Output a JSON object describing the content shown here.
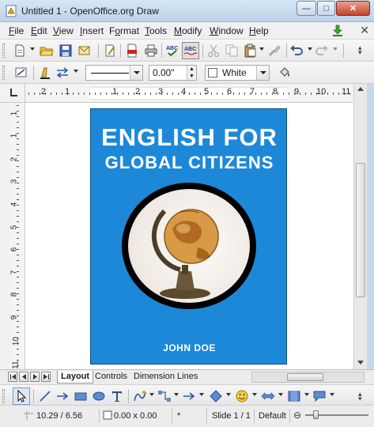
{
  "window": {
    "title": "Untitled 1 - OpenOffice.org Draw",
    "app_icon": "openoffice-draw-icon",
    "buttons": [
      "minimize-icon",
      "maximize-icon",
      "close-icon"
    ]
  },
  "menubar": {
    "items": [
      {
        "label": "File",
        "key": "F",
        "rest": "ile"
      },
      {
        "label": "Edit",
        "key": "E",
        "rest": "dit"
      },
      {
        "label": "View",
        "key": "V",
        "rest": "iew"
      },
      {
        "label": "Insert",
        "key": "I",
        "rest": "nsert"
      },
      {
        "label": "Format",
        "key": "o",
        "pre": "F",
        "rest": "rmat"
      },
      {
        "label": "Tools",
        "key": "T",
        "rest": "ools"
      },
      {
        "label": "Modify",
        "key": "M",
        "rest": "odify"
      },
      {
        "label": "Window",
        "key": "W",
        "rest": "indow"
      },
      {
        "label": "Help",
        "key": "H",
        "rest": "elp"
      }
    ]
  },
  "line_toolbar": {
    "line_width": "0.00\"",
    "fill_color": "White"
  },
  "ruler": {
    "h_labels": [
      "2",
      "1",
      "1",
      "2",
      "3",
      "4",
      "5",
      "6",
      "7",
      "8",
      "9",
      "10",
      "11"
    ],
    "v_labels": [
      "1",
      "1",
      "2",
      "3",
      "4",
      "5",
      "6",
      "7",
      "8",
      "9",
      "10",
      "11"
    ]
  },
  "cover": {
    "title_line1": "ENGLISH FOR",
    "title_line2": "GLOBAL CITIZENS",
    "author": "JOHN DOE",
    "background": "#1e88d8"
  },
  "tabs": [
    "Layout",
    "Controls",
    "Dimension Lines"
  ],
  "statusbar": {
    "position": "10.29 / 6.56",
    "size": "0.00 x 0.00",
    "modified": "*",
    "slide": "Slide 1 / 1",
    "layout": "Default"
  }
}
